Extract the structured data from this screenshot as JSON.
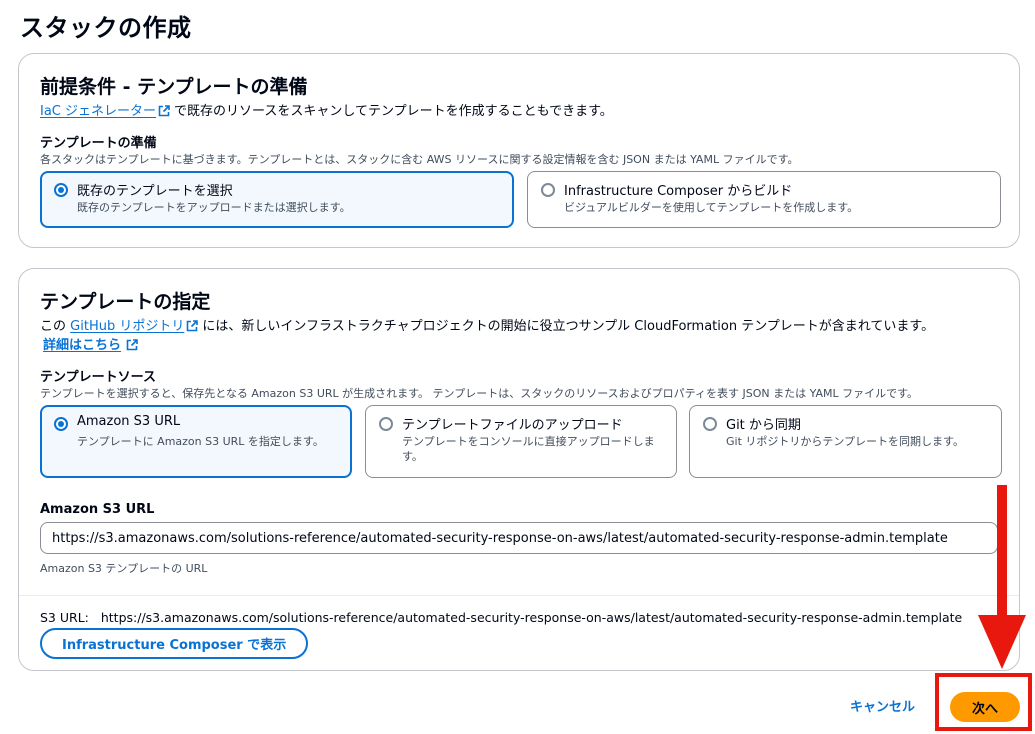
{
  "page": {
    "title": "スタックの作成"
  },
  "prereq": {
    "title": "前提条件 - テンプレートの準備",
    "iac_link": "IaC ジェネレーター",
    "iac_text": "で既存のリソースをスキャンしてテンプレートを作成することもできます。",
    "prep_label": "テンプレートの準備",
    "prep_hint": "各スタックはテンプレートに基づきます。テンプレートとは、スタックに含む AWS リソースに関する設定情報を含む JSON または YAML ファイルです。",
    "options": [
      {
        "title": "既存のテンプレートを選択",
        "desc": "既存のテンプレートをアップロードまたは選択します。",
        "selected": true
      },
      {
        "title": "Infrastructure Composer からビルド",
        "desc": "ビジュアルビルダーを使用してテンプレートを作成します。",
        "selected": false
      }
    ]
  },
  "spec": {
    "title": "テンプレートの指定",
    "intro_before": "この",
    "github_link": "GitHub リポジトリ",
    "intro_after": "には、新しいインフラストラクチャプロジェクトの開始に役立つサンプル CloudFormation テンプレートが含まれています。",
    "details_link": "詳細はこちら",
    "source_label": "テンプレートソース",
    "source_hint": "テンプレートを選択すると、保存先となる Amazon S3 URL が生成されます。 テンプレートは、スタックのリソースおよびプロパティを表す JSON または YAML ファイルです。",
    "sources": [
      {
        "title": "Amazon S3 URL",
        "desc": "テンプレートに Amazon S3 URL を指定します。",
        "selected": true
      },
      {
        "title": "テンプレートファイルのアップロード",
        "desc": "テンプレートをコンソールに直接アップロードします。",
        "selected": false
      },
      {
        "title": "Git から同期",
        "desc": "Git リポジトリからテンプレートを同期します。",
        "selected": false
      }
    ],
    "s3_label": "Amazon S3 URL",
    "s3_value": "https://s3.amazonaws.com/solutions-reference/automated-security-response-on-aws/latest/automated-security-response-admin.template",
    "s3_constraint": "Amazon S3 テンプレートの URL",
    "s3_url_prefix": "S3 URL:",
    "s3_url_value": "https://s3.amazonaws.com/solutions-reference/automated-security-response-on-aws/latest/automated-security-response-admin.template",
    "composer_button": "Infrastructure Composer で表示"
  },
  "footer": {
    "cancel": "キャンセル",
    "next": "次へ"
  },
  "colors": {
    "link": "#0972d3",
    "primary_button": "#ff9900",
    "annotation": "#e8180f",
    "selected_tile_bg": "#f2f8fd"
  }
}
